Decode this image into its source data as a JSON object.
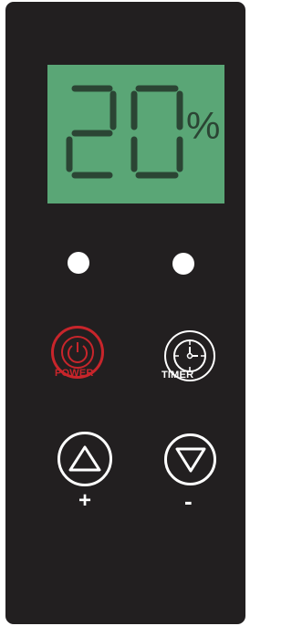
{
  "display": {
    "value": "20",
    "unit": "%"
  },
  "indicators": [
    {
      "name": "indicator-left",
      "state": "on"
    },
    {
      "name": "indicator-right",
      "state": "on"
    }
  ],
  "buttons": {
    "power": {
      "label": "POWER",
      "icon": "power-icon"
    },
    "timer": {
      "label": "TIMER",
      "icon": "clock-icon"
    },
    "up": {
      "label": "+",
      "icon": "triangle-up-icon"
    },
    "down": {
      "label": "-",
      "icon": "triangle-down-icon"
    }
  },
  "colors": {
    "panel": "#221f20",
    "lcd_background": "#5aa676",
    "lcd_segments": "#2b4534",
    "power_accent": "#c8252b",
    "foreground": "#ffffff"
  }
}
